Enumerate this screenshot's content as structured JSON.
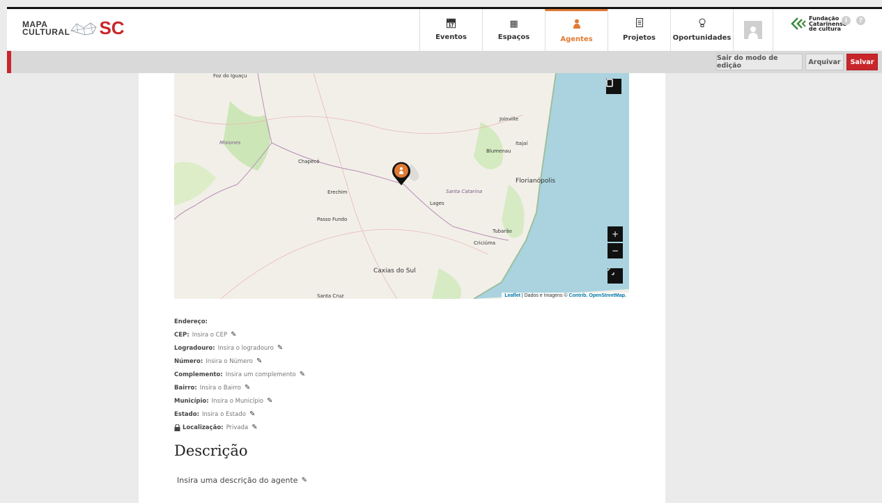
{
  "logo": {
    "line1": "MAPA",
    "line2": "CULTURAL",
    "sc": "SC"
  },
  "nav": [
    {
      "label": "Eventos",
      "icon": "calendar-icon"
    },
    {
      "label": "Espaços",
      "icon": "building-icon"
    },
    {
      "label": "Agentes",
      "icon": "person-icon",
      "active": true
    },
    {
      "label": "Projetos",
      "icon": "document-icon"
    },
    {
      "label": "Oportunidades",
      "icon": "lightbulb-icon"
    }
  ],
  "partner": {
    "line1": "Fundação",
    "line2": "Catarinense",
    "line3": "de cultura"
  },
  "toolbar": {
    "exit_label": "Sair do modo de edição",
    "archive_label": "Arquivar",
    "save_label": "Salvar"
  },
  "map": {
    "labels": {
      "foz": "Foz do Iguaçu",
      "misiones": "Misiones",
      "joinville": "Joinville",
      "itajai": "Itajaí",
      "blumenau": "Blumenau",
      "chapeco": "Chapecó",
      "florianopolis": "Florianópolis",
      "santa_catarina": "Santa Catarina",
      "erechim": "Erechim",
      "lages": "Lages",
      "passo_fundo": "Passo Fundo",
      "tubarao": "Tubarão",
      "criciuma": "Criciúma",
      "caxias": "Caxias do Sul",
      "santa_cruz": "Santa Cruz"
    },
    "zoom_in": "+",
    "zoom_out": "−",
    "attribution_leaflet": "Leaflet",
    "attribution_mid": " | Dados e Imagens © ",
    "attribution_osm": "Contrib. OpenStreetMap."
  },
  "address": {
    "heading": "Endereço:",
    "rows": [
      {
        "label": "CEP:",
        "value": "Insira o CEP"
      },
      {
        "label": "Logradouro:",
        "value": "Insira o logradouro"
      },
      {
        "label": "Número:",
        "value": "Insira o Número"
      },
      {
        "label": "Complemento:",
        "value": "Insira um complemento"
      },
      {
        "label": "Bairro:",
        "value": "Insira o Bairro"
      },
      {
        "label": "Município:",
        "value": "Insira o Município"
      },
      {
        "label": "Estado:",
        "value": "Insira o Estado"
      },
      {
        "label": "Localização:",
        "value": "Privada"
      }
    ]
  },
  "description": {
    "title": "Descrição",
    "placeholder": "Insira uma descrição do agente"
  },
  "colors": {
    "accent": "#e07a34",
    "brand_red": "#c8262b",
    "sea": "#aad3df"
  }
}
